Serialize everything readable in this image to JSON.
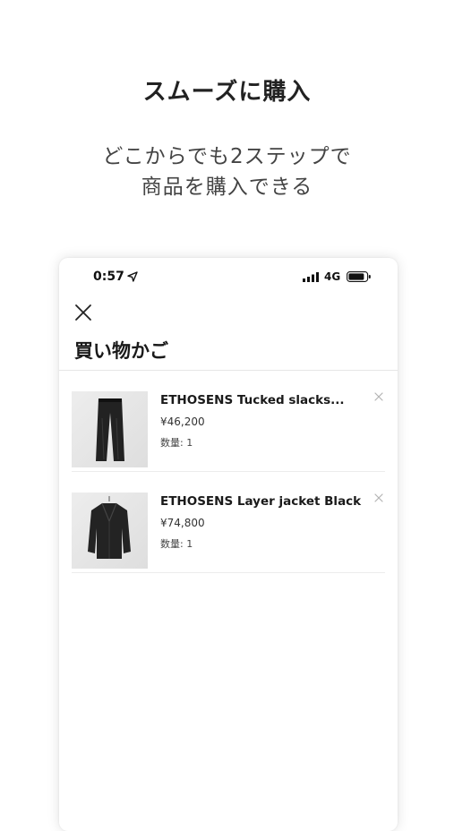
{
  "promo": {
    "headline": "スムーズに購入",
    "subline_1": "どこからでも2ステップで",
    "subline_2": "商品を購入できる"
  },
  "status_bar": {
    "time": "0:57",
    "network": "4G",
    "icons": [
      "location-arrow-icon",
      "signal-icon",
      "battery-icon"
    ]
  },
  "cart": {
    "title": "買い物かご",
    "close_icon": "close-icon",
    "items": [
      {
        "name": "ETHOSENS  Tucked slacks...",
        "price": "¥46,200",
        "quantity": "数量: 1",
        "image": "black slacks"
      },
      {
        "name": "ETHOSENS Layer jacket Black",
        "price": "¥74,800",
        "quantity": "数量: 1",
        "image": "black jacket"
      }
    ]
  }
}
